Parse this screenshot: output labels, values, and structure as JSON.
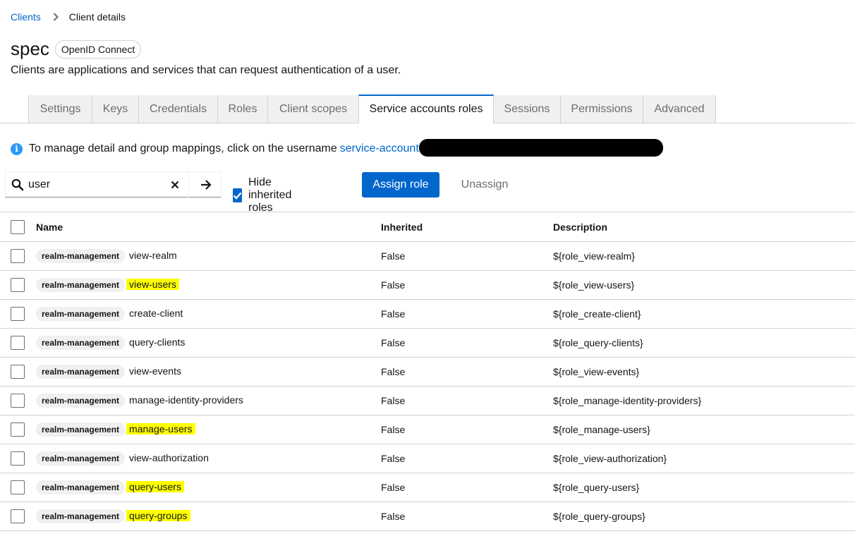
{
  "breadcrumb": {
    "parent": "Clients",
    "current": "Client details"
  },
  "header": {
    "title": "spec",
    "badge": "OpenID Connect",
    "subtitle": "Clients are applications and services that can request authentication of a user."
  },
  "tabs": [
    {
      "label": "Settings"
    },
    {
      "label": "Keys"
    },
    {
      "label": "Credentials"
    },
    {
      "label": "Roles"
    },
    {
      "label": "Client scopes"
    },
    {
      "label": "Service accounts roles"
    },
    {
      "label": "Sessions"
    },
    {
      "label": "Permissions"
    },
    {
      "label": "Advanced"
    }
  ],
  "active_tab": "Service accounts roles",
  "info": {
    "text": "To manage detail and group mappings, click on the username",
    "link": "service-account"
  },
  "toolbar": {
    "search_value": "user",
    "hide_inherited_label": "Hide inherited roles",
    "hide_inherited_checked": true,
    "assign_label": "Assign role",
    "unassign_label": "Unassign"
  },
  "table": {
    "columns": {
      "name": "Name",
      "inherited": "Inherited",
      "description": "Description"
    },
    "rows": [
      {
        "client": "realm-management",
        "role": "view-realm",
        "inherited": "False",
        "description": "${role_view-realm}",
        "highlight": false
      },
      {
        "client": "realm-management",
        "role": "view-users",
        "inherited": "False",
        "description": "${role_view-users}",
        "highlight": true
      },
      {
        "client": "realm-management",
        "role": "create-client",
        "inherited": "False",
        "description": "${role_create-client}",
        "highlight": false
      },
      {
        "client": "realm-management",
        "role": "query-clients",
        "inherited": "False",
        "description": "${role_query-clients}",
        "highlight": false
      },
      {
        "client": "realm-management",
        "role": "view-events",
        "inherited": "False",
        "description": "${role_view-events}",
        "highlight": false
      },
      {
        "client": "realm-management",
        "role": "manage-identity-providers",
        "inherited": "False",
        "description": "${role_manage-identity-providers}",
        "highlight": false
      },
      {
        "client": "realm-management",
        "role": "manage-users",
        "inherited": "False",
        "description": "${role_manage-users}",
        "highlight": true
      },
      {
        "client": "realm-management",
        "role": "view-authorization",
        "inherited": "False",
        "description": "${role_view-authorization}",
        "highlight": false
      },
      {
        "client": "realm-management",
        "role": "query-users",
        "inherited": "False",
        "description": "${role_query-users}",
        "highlight": true
      },
      {
        "client": "realm-management",
        "role": "query-groups",
        "inherited": "False",
        "description": "${role_query-groups}",
        "highlight": true
      }
    ]
  },
  "colors": {
    "accent": "#0066cc",
    "info": "#2b9af3",
    "highlight": "#ffff00"
  }
}
